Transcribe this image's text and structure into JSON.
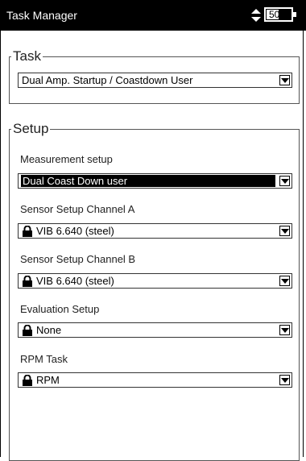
{
  "header": {
    "title": "Task Manager",
    "battery_text": "50%",
    "battery_level": 0.5
  },
  "task": {
    "legend": "Task",
    "value": "Dual Amp. Startup / Coastdown User"
  },
  "setup": {
    "legend": "Setup",
    "fields": [
      {
        "label": "Measurement setup",
        "value": "Dual Coast Down user"
      },
      {
        "label": "Sensor Setup Channel A",
        "value": "VIB 6.640 (steel)"
      },
      {
        "label": "Sensor Setup Channel B",
        "value": "VIB 6.640 (steel)"
      },
      {
        "label": "Evaluation Setup",
        "value": "None"
      },
      {
        "label": "RPM Task",
        "value": "RPM"
      }
    ]
  }
}
